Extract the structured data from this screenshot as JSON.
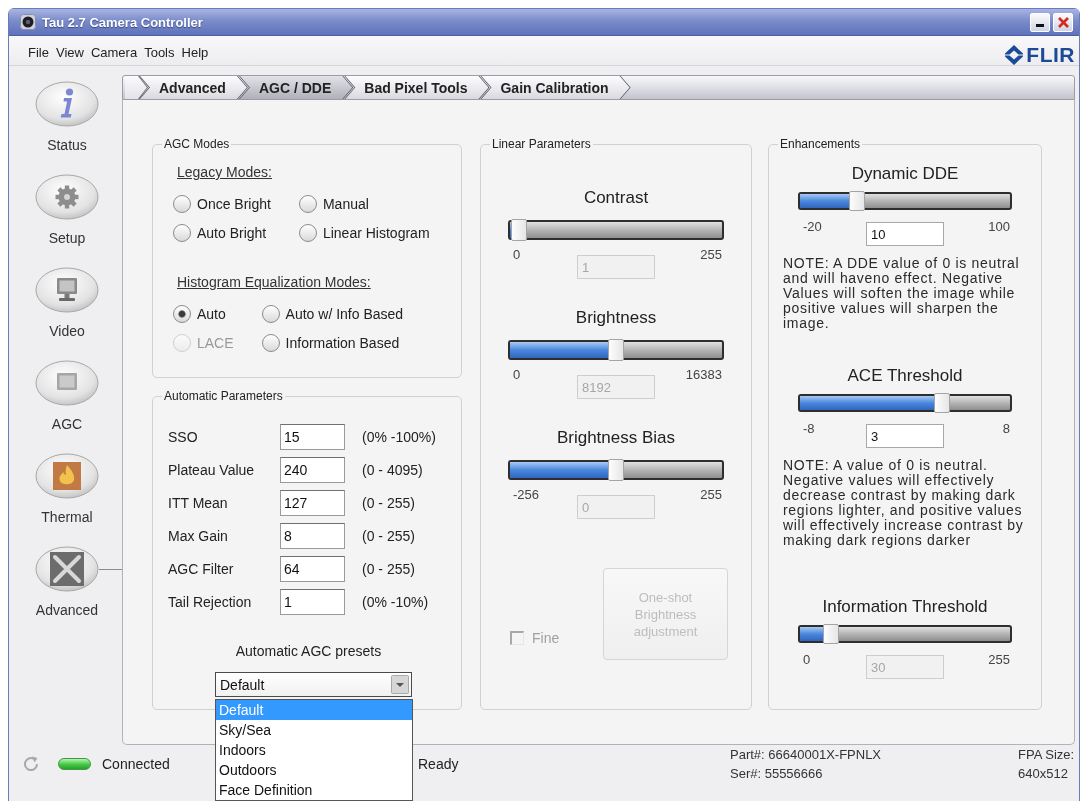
{
  "window": {
    "title": "Tau 2.7 Camera Controller"
  },
  "menu": [
    {
      "label": "File"
    },
    {
      "label": "View"
    },
    {
      "label": "Camera"
    },
    {
      "label": "Tools"
    },
    {
      "label": "Help"
    }
  ],
  "logo": {
    "text": "FLIR"
  },
  "tabs": [
    {
      "label": "Advanced",
      "selected": false
    },
    {
      "label": "AGC / DDE",
      "selected": true
    },
    {
      "label": "Bad Pixel Tools",
      "selected": false
    },
    {
      "label": "Gain Calibration",
      "selected": false
    }
  ],
  "sidebar": {
    "items": [
      {
        "label": "Status",
        "selected": false
      },
      {
        "label": "Setup",
        "selected": false
      },
      {
        "label": "Video",
        "selected": false
      },
      {
        "label": "AGC",
        "selected": false
      },
      {
        "label": "Thermal",
        "selected": false
      },
      {
        "label": "Advanced",
        "selected": true
      }
    ]
  },
  "agc_modes": {
    "title": "AGC Modes",
    "groups": [
      {
        "heading": "Legacy Modes:",
        "options": [
          {
            "label": "Once Bright",
            "selected": false,
            "disabled": false
          },
          {
            "label": "Manual",
            "selected": false,
            "disabled": false
          },
          {
            "label": "Auto Bright",
            "selected": false,
            "disabled": false
          },
          {
            "label": "Linear Histogram",
            "selected": false,
            "disabled": false
          }
        ]
      },
      {
        "heading": "Histogram Equalization Modes:",
        "options": [
          {
            "label": "Auto",
            "selected": true,
            "disabled": false
          },
          {
            "label": "Auto w/ Info Based",
            "selected": false,
            "disabled": false
          },
          {
            "label": "LACE",
            "selected": false,
            "disabled": true
          },
          {
            "label": "Information Based",
            "selected": false,
            "disabled": false
          }
        ]
      }
    ]
  },
  "automatic_parameters": {
    "title": "Automatic Parameters",
    "rows": [
      {
        "label": "SSO",
        "value": "15",
        "range": "(0% -100%)"
      },
      {
        "label": "Plateau Value",
        "value": "240",
        "range": "(0 - 4095)"
      },
      {
        "label": "ITT Mean",
        "value": "127",
        "range": "(0 - 255)"
      },
      {
        "label": "Max Gain",
        "value": "8",
        "range": "(0 - 255)"
      },
      {
        "label": "AGC Filter",
        "value": "64",
        "range": "(0 - 255)"
      },
      {
        "label": "Tail Rejection",
        "value": "1",
        "range": "(0% -10%)"
      }
    ],
    "presets": {
      "label": "Automatic AGC presets",
      "value": "Default",
      "expanded": true,
      "options": [
        {
          "label": "Default",
          "selected": true
        },
        {
          "label": "Sky/Sea",
          "selected": false
        },
        {
          "label": "Indoors",
          "selected": false
        },
        {
          "label": "Outdoors",
          "selected": false
        },
        {
          "label": "Face Definition",
          "selected": false
        }
      ]
    }
  },
  "linear_parameters": {
    "title": "Linear Parameters",
    "sliders": [
      {
        "label": "Contrast",
        "level": 0.004,
        "min": "0",
        "max": "255",
        "value": "1",
        "disabled": true
      },
      {
        "label": "Brightness",
        "level": 0.5,
        "min": "0",
        "max": "16383",
        "value": "8192",
        "disabled": true
      },
      {
        "label": "Brightness Bias",
        "level": 0.5,
        "min": "-256",
        "max": "255",
        "value": "0",
        "disabled": true
      }
    ],
    "fine": {
      "label": "Fine",
      "checked": false,
      "disabled": true
    },
    "button": {
      "label": "One-shot Brightness adjustment",
      "disabled": true
    }
  },
  "enhancements": {
    "title": "Enhancements",
    "sliders": [
      {
        "label": "Dynamic DDE",
        "level": 0.25,
        "min": "-20",
        "max": "100",
        "value": "10",
        "disabled": false,
        "note": "NOTE: A DDE value of 0 is neutral and will haveno effect. Negative Values will soften the image while positive values will sharpen the image."
      },
      {
        "label": "ACE Threshold",
        "level": 0.69,
        "min": "-8",
        "max": "8",
        "value": "3",
        "disabled": false,
        "note": "NOTE: A value of 0 is neutral. Negative values will effectively decrease contrast by making dark regions lighter, and positive values will effectively increase contrast by making dark regions darker"
      },
      {
        "label": "Information Threshold",
        "level": 0.12,
        "min": "0",
        "max": "255",
        "value": "30",
        "disabled": true
      }
    ]
  },
  "status_bar": {
    "connection": {
      "label": "Connected",
      "on": true
    },
    "status": "Ready",
    "part": "Part#: 66640001X-FPNLX",
    "serial": "Ser#: 55556666",
    "fpa_label": "FPA Size:",
    "fpa_value": "640x512"
  }
}
